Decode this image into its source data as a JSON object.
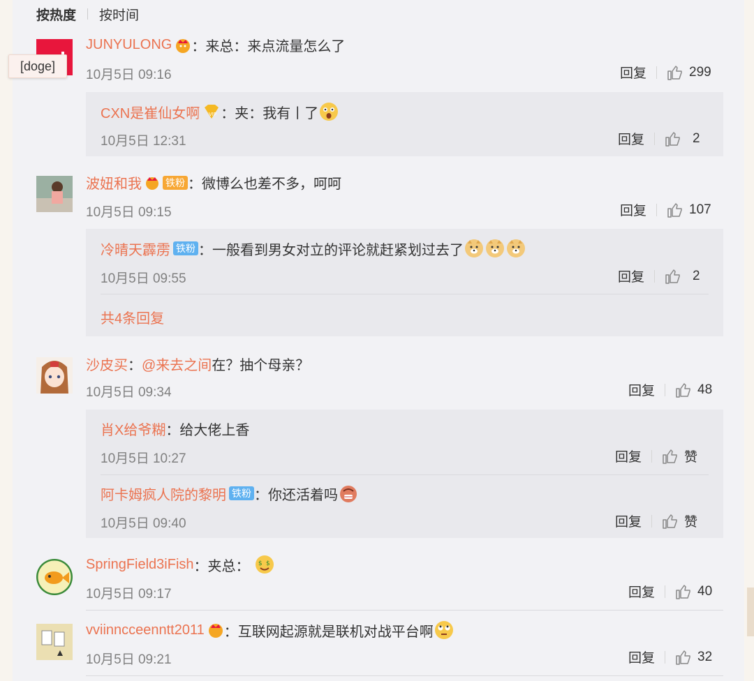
{
  "sort": {
    "hot": "按热度",
    "time": "按时间"
  },
  "tooltip": "[doge]",
  "colors": {
    "username": "#eb7350",
    "badge_blue": "#5fb1f0"
  },
  "labels": {
    "reply": "回复",
    "like": "赞",
    "colon": "："
  },
  "comments": [
    {
      "user": "JUNYULONG",
      "text": "：来总：来点流量怎么了",
      "time": "10月5日 09:16",
      "likes": "299",
      "replies": [
        {
          "user": "CXN是崔仙女啊",
          "text": "：夹：我有丨了",
          "time": "10月5日 12:31",
          "likes": "2"
        }
      ]
    },
    {
      "user": "波妞和我",
      "badge": "铁粉",
      "text": "：微博么也差不多，呵呵",
      "time": "10月5日 09:15",
      "likes": "107",
      "replies": [
        {
          "user": "冷晴天霹雳",
          "badge": "铁粉",
          "text": "：一般看到男女对立的评论就赶紧划过去了",
          "time": "10月5日 09:55",
          "likes": "2"
        }
      ],
      "more": "共4条回复"
    },
    {
      "user": "沙皮买",
      "mention": "@来去之间",
      "text": "：",
      "text2": " 在？抽个母亲？",
      "time": "10月5日 09:34",
      "likes": "48",
      "replies": [
        {
          "user": "肖X给爷糊",
          "text": "：给大佬上香",
          "time": "10月5日 10:27",
          "likes": "赞"
        },
        {
          "user": "阿卡姆疯人院的黎明",
          "badge": "铁粉",
          "text": "：你还活着吗",
          "time": "10月5日 09:40",
          "likes": "赞"
        }
      ]
    },
    {
      "user": "SpringField3iFish",
      "text": "：夹总：",
      "time": "10月5日 09:17",
      "likes": "40"
    },
    {
      "user": "vviinncceenntt2011",
      "text": "：互联网起源就是联机对战平台啊",
      "time": "10月5日 09:21",
      "likes": "32"
    }
  ]
}
